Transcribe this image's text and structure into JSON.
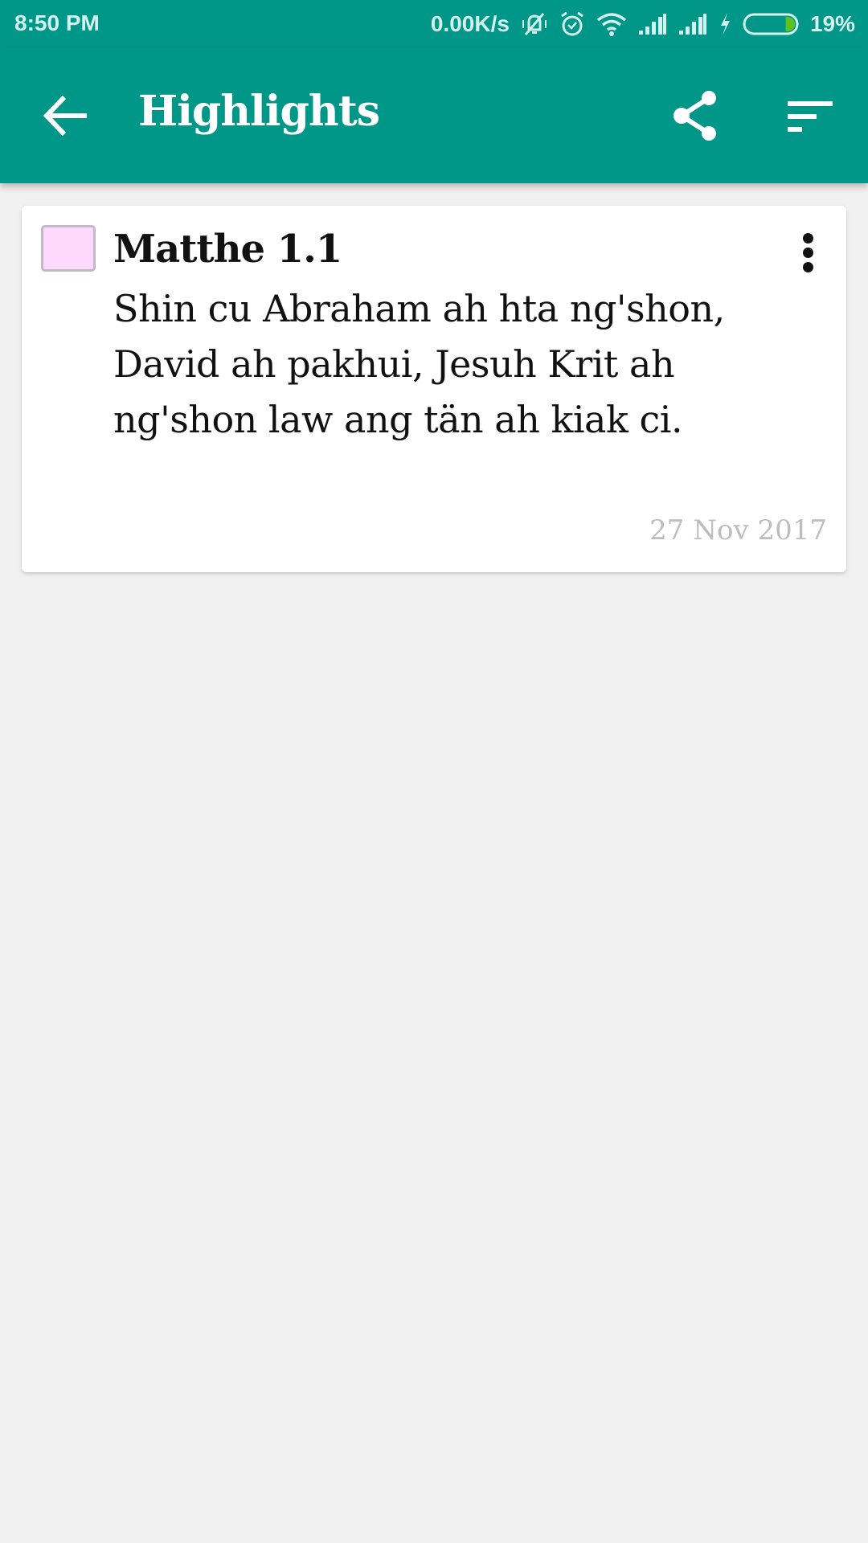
{
  "status_bar": {
    "time": "8:50 PM",
    "network_speed": "0.00K/s",
    "icons": [
      "vibrate-silent-icon",
      "alarm-icon",
      "wifi-icon",
      "signal-icon",
      "signal-icon",
      "charging-icon",
      "battery-icon"
    ],
    "battery_percent": "19%",
    "battery_level": 0.19,
    "battery_fill_color": "#5dc21e"
  },
  "app_bar": {
    "title": "Highlights",
    "back_icon": "arrow-back-icon",
    "share_icon": "share-icon",
    "sort_icon": "sort-icon",
    "background_color": "#009688"
  },
  "highlights": [
    {
      "reference": "Matthe 1.1",
      "text": "Shin cu Abraham ah hta ng'shon, David ah pakhui, Jesuh Krit ah ng'shon law ang tän ah kiak ci.",
      "date": "27 Nov 2017",
      "highlight_color": "#ffd9fd",
      "menu_icon": "more-vert-icon"
    }
  ]
}
